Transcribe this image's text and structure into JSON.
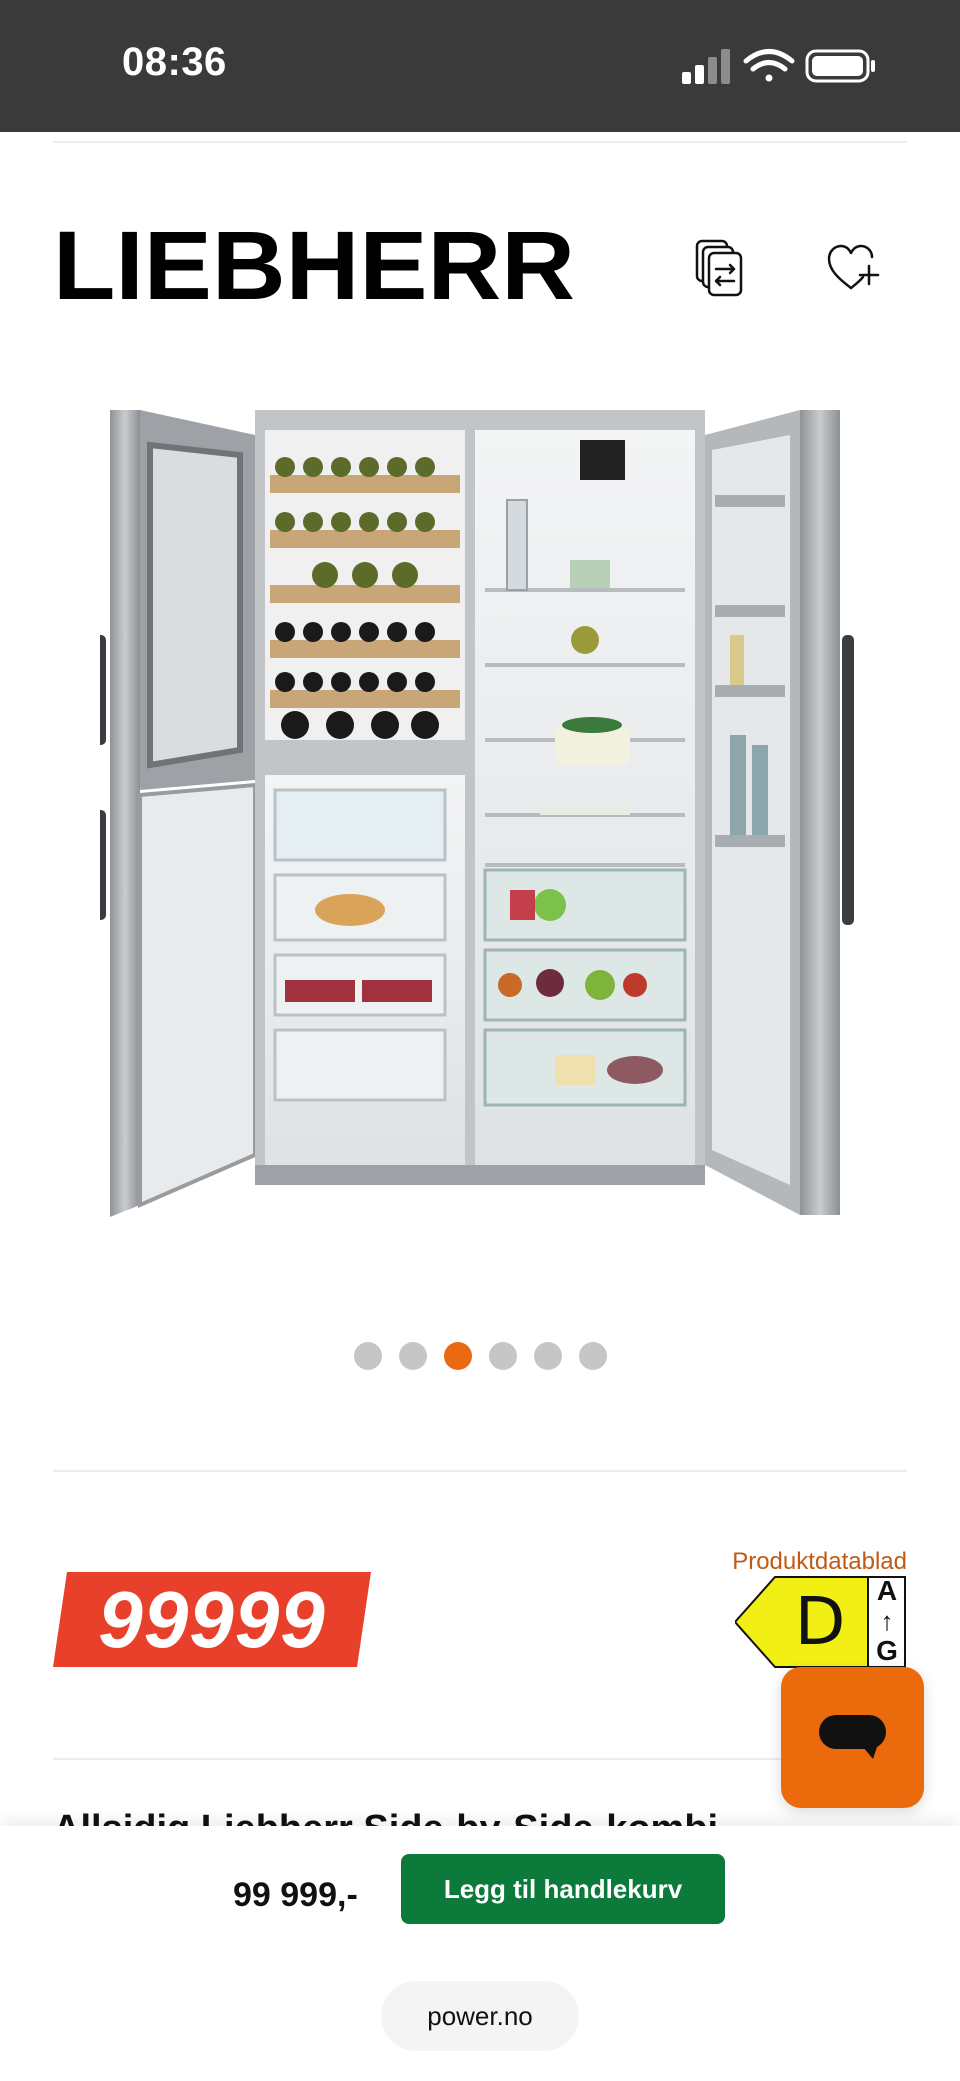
{
  "status_bar": {
    "time": "08:36",
    "icons": [
      "signal-icon",
      "wifi-icon",
      "battery-icon"
    ]
  },
  "brand": {
    "name": "LIEBHERR",
    "compare_icon": "compare-icon",
    "wishlist_icon": "heart-plus-icon"
  },
  "product_image": {
    "alt": "Liebherr side-by-side fridge, wine cabinet and freezer with open doors"
  },
  "carousel": {
    "total": 6,
    "active_index": 2
  },
  "price": {
    "badge": "99999",
    "datasheet_link": "Produktdatablad",
    "energy_class": "D",
    "energy_scale_top": "A",
    "energy_scale_arrow": "↑",
    "energy_scale_bottom": "G"
  },
  "product": {
    "title_partial": "Allsidig Liebherr Side-by-Side-kombi"
  },
  "bottom_bar": {
    "price": "99 999,-",
    "cta_label": "Legg til handlekurv"
  },
  "browser": {
    "url": "power.no"
  },
  "colors": {
    "accent_orange": "#ea6a12",
    "price_red": "#e8402a",
    "cta_green": "#0c7a3a",
    "energy_yellow": "#f2ef15",
    "status_bar": "#3a3a3a"
  }
}
